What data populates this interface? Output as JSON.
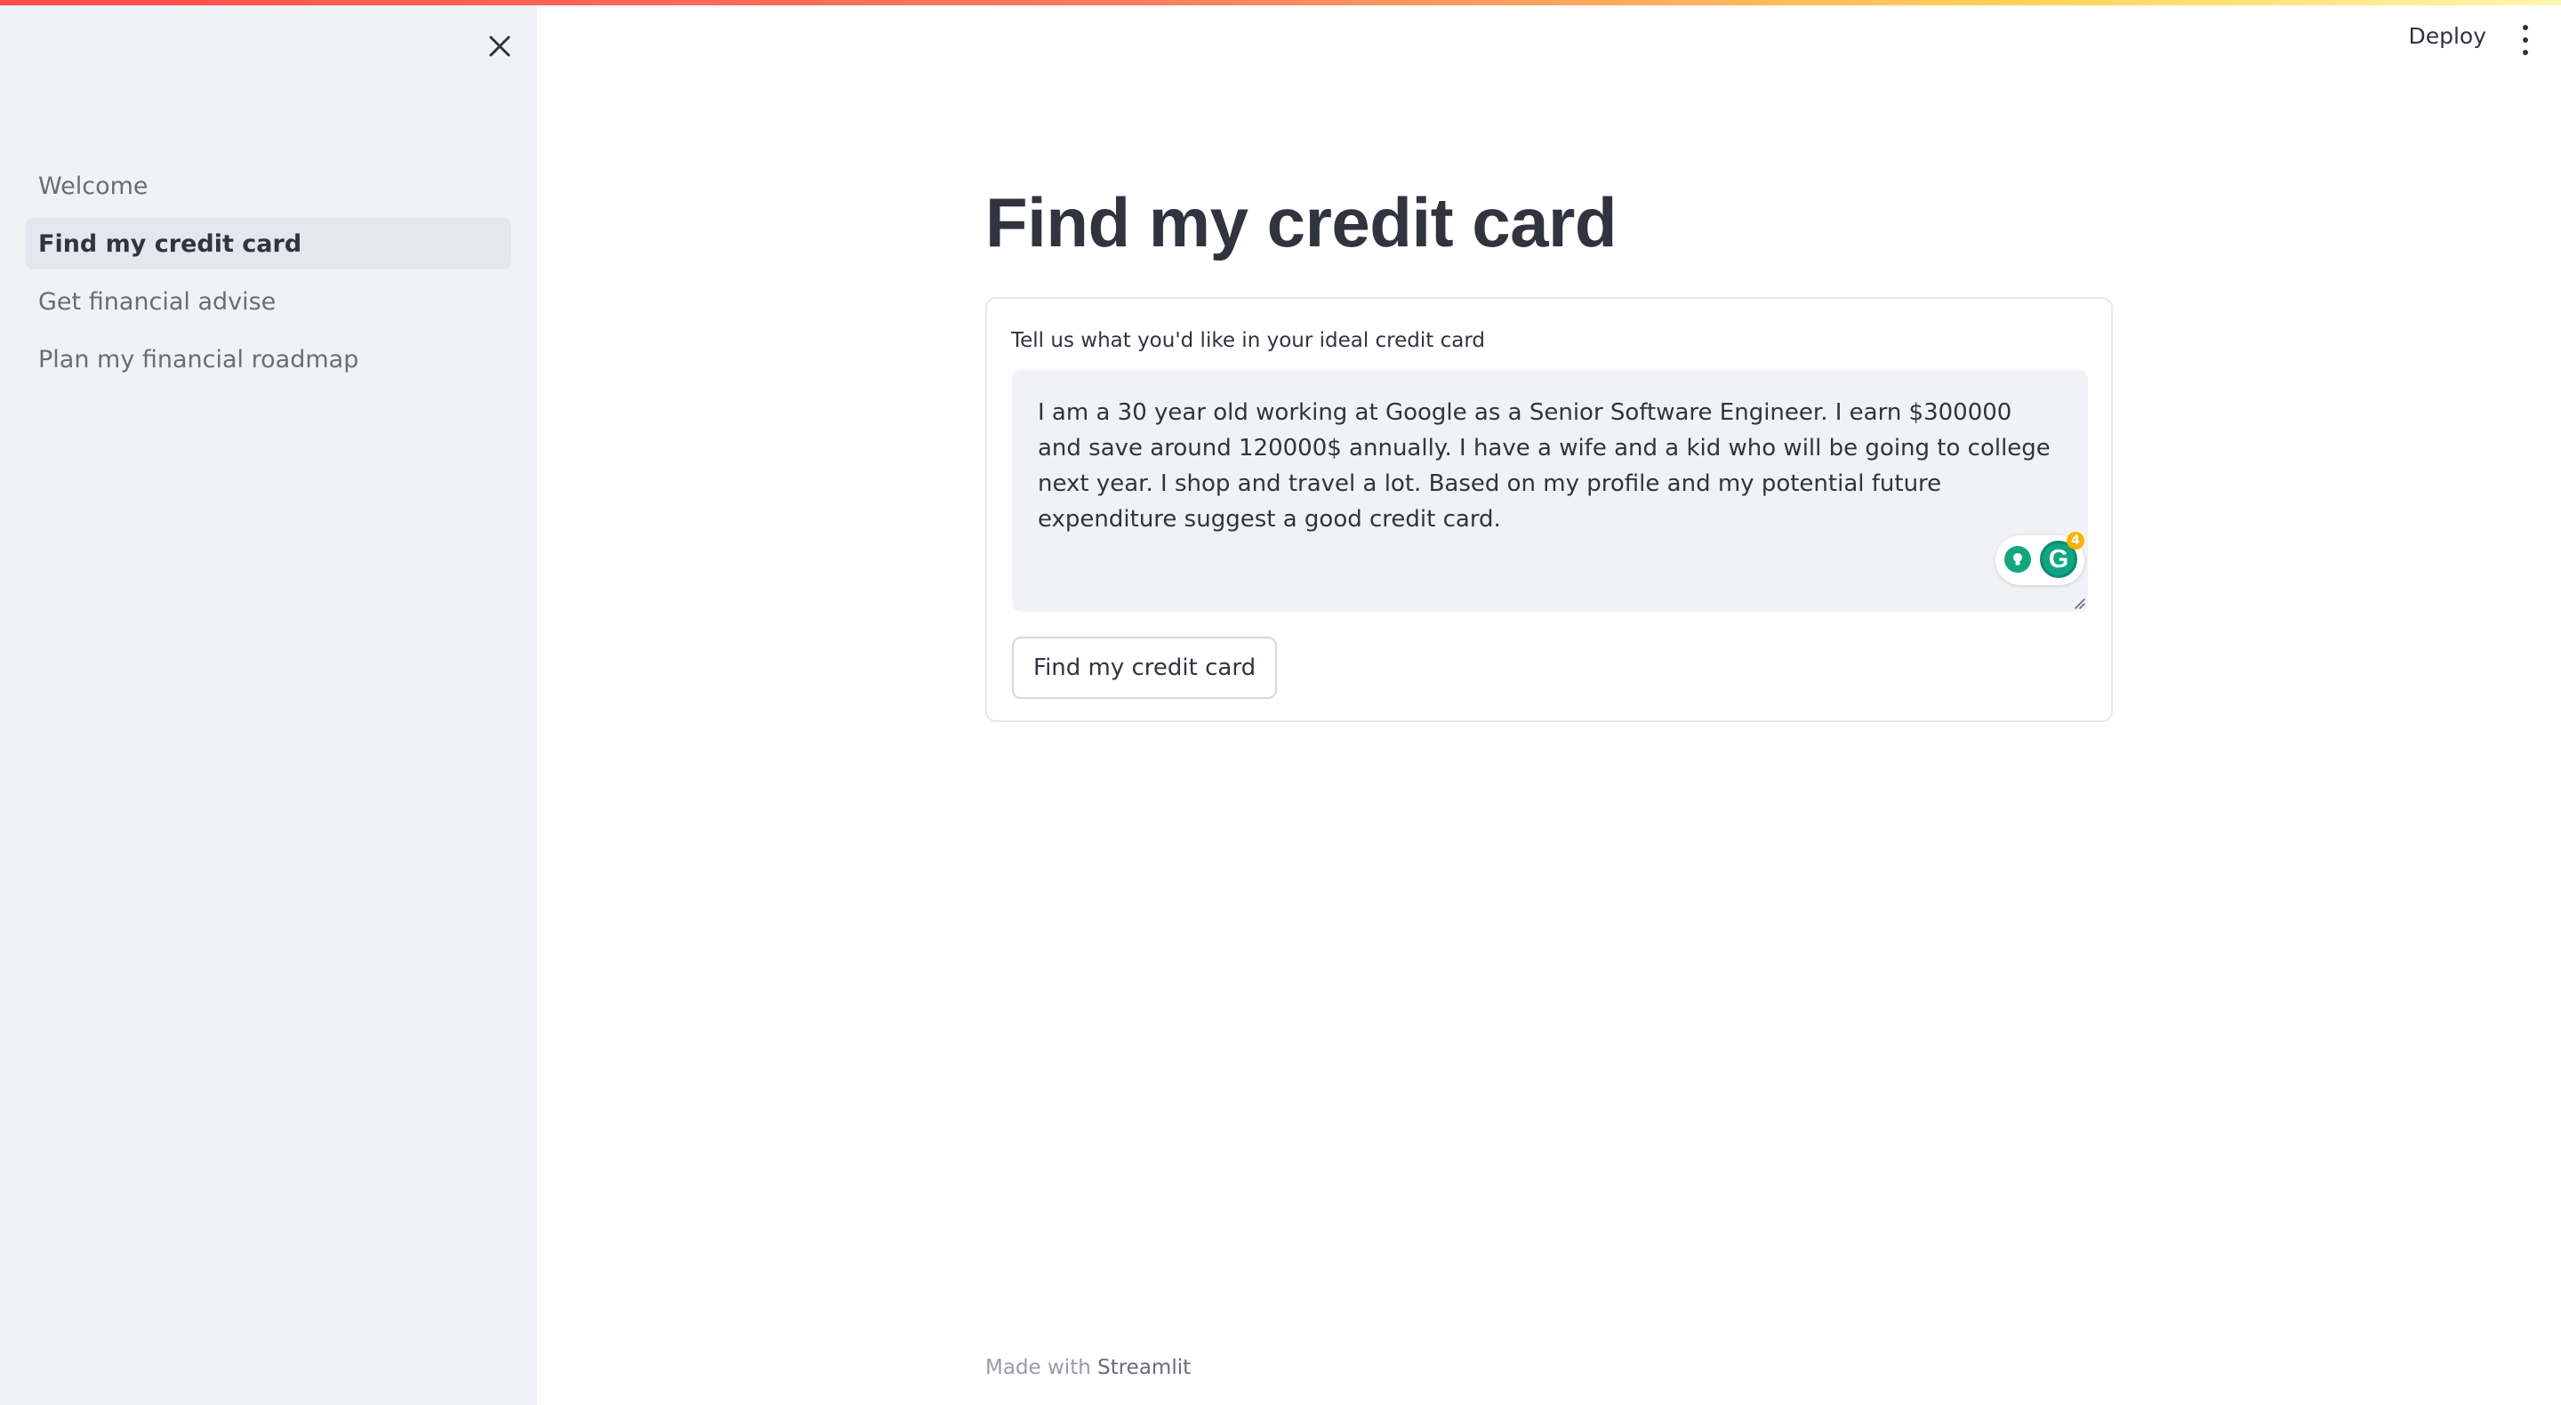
{
  "sidebar": {
    "close_icon": "close-icon",
    "items": [
      {
        "label": "Welcome",
        "active": false
      },
      {
        "label": "Find my credit card",
        "active": true
      },
      {
        "label": "Get financial advise",
        "active": false
      },
      {
        "label": "Plan my financial roadmap",
        "active": false
      }
    ]
  },
  "header": {
    "deploy_label": "Deploy",
    "menu_icon": "vertical-ellipsis-icon"
  },
  "main": {
    "title": "Find my credit card",
    "form": {
      "label": "Tell us what you'd like in your ideal credit card",
      "textarea_value": "I am a 30 year old working at Google as a Senior Software Engineer. I earn $300000 and save around 120000$ annually. I have a wife and a kid who will be going to college next year. I shop and travel a lot. Based on my profile and my potential future expenditure suggest a good credit card.",
      "grammarly_count": "4",
      "submit_label": "Find my credit card"
    }
  },
  "footer": {
    "made_with": "Made with",
    "brand": "Streamlit"
  },
  "colors": {
    "accent": "#ff4b4b",
    "sidebar_bg": "#f0f2f6",
    "text": "#31333f",
    "grammarly_green": "#11a683"
  }
}
